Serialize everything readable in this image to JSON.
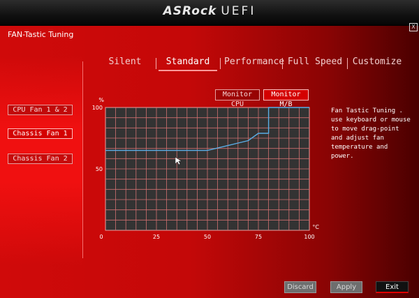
{
  "brand": {
    "part1": "ASRock",
    "part2": "UEFI"
  },
  "close_label": "X",
  "page_title": "FAN-Tastic Tuning",
  "tabs": [
    {
      "label": "Silent",
      "active": false
    },
    {
      "label": "Standard",
      "active": true
    },
    {
      "label": "Performance",
      "active": false
    },
    {
      "label": "Full Speed",
      "active": false
    },
    {
      "label": "Customize",
      "active": false
    }
  ],
  "fans": [
    {
      "label": "CPU Fan 1 & 2",
      "active": false
    },
    {
      "label": "Chassis Fan 1",
      "active": true
    },
    {
      "label": "Chassis Fan 2",
      "active": false
    }
  ],
  "monitor": {
    "cpu": "Monitor CPU",
    "mb": "Monitor M/B",
    "active": "mb"
  },
  "help_text": "Fan Tastic Tuning . use keyboard or mouse to move drag-point and adjust fan temperature and power.",
  "buttons": {
    "discard": "Discard",
    "apply": "Apply",
    "exit": "Exit"
  },
  "colors": {
    "accent": "#d40000",
    "curve": "#5aaee6",
    "grid": "#d07070",
    "plot_bg": "#333333"
  },
  "chart_data": {
    "type": "line",
    "xlabel": "°C",
    "ylabel": "%",
    "xlim": [
      0,
      100
    ],
    "ylim": [
      0,
      100
    ],
    "xticks": [
      0,
      25,
      50,
      75,
      100
    ],
    "yticks": [
      50,
      100
    ],
    "grid": true,
    "series": [
      {
        "x": [
          0,
          50,
          55,
          60,
          65,
          70,
          75,
          80,
          80,
          100
        ],
        "y": [
          65,
          65,
          67,
          69,
          71,
          73,
          79,
          79,
          100,
          100
        ]
      }
    ]
  }
}
